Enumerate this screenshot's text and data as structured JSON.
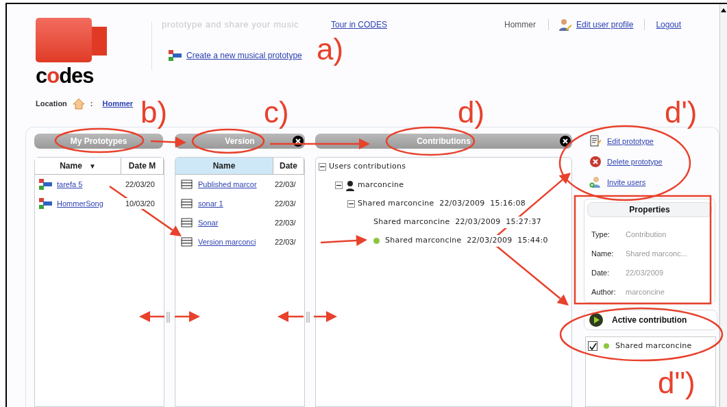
{
  "logo": {
    "text": "codes"
  },
  "header": {
    "tagline": "prototype and share your music",
    "tour_link": "Tour in CODES",
    "create_link": "Create a new musical prototype",
    "user": "Hommer",
    "edit_profile": "Edit user profile",
    "logout": "Logout"
  },
  "location": {
    "label": "Location",
    "separator": ":",
    "link": "Hommer"
  },
  "prototypes": {
    "title": "My Prototypes",
    "columns": [
      {
        "label": "Name",
        "sort_indicator": "▼",
        "selected": false
      },
      {
        "label": "Date M",
        "selected": false
      }
    ],
    "rows": [
      {
        "name": "tarefa 5",
        "date": "22/03/20"
      },
      {
        "name": "HommerSong",
        "date": "10/03/20"
      }
    ]
  },
  "versions": {
    "title": "Version",
    "closable": true,
    "columns": [
      {
        "label": "Name",
        "selected": true
      },
      {
        "label": "Date",
        "selected": false
      }
    ],
    "rows": [
      {
        "name": "Published marcor",
        "date": "22/03/"
      },
      {
        "name": "sonar 1",
        "date": "22/03/"
      },
      {
        "name": "Sonar",
        "date": "22/03/"
      },
      {
        "name": "Version marconci",
        "date": "22/03/"
      }
    ]
  },
  "contributions": {
    "title": "Contributions",
    "closable": true,
    "tree": [
      {
        "label": "Users contributions",
        "expanded": true,
        "children": [
          {
            "label": "marconcine",
            "kind": "user",
            "expanded": true,
            "children": [
              {
                "label": "Shared marconcine  22/03/2009  15:16:08",
                "expanded": true,
                "active": false,
                "children": [
                  {
                    "label": "Shared marconcine  22/03/2009  15:27:37",
                    "active": false
                  },
                  {
                    "label": "Shared marconcine  22/03/2009  15:44:0",
                    "active": true
                  }
                ]
              }
            ]
          }
        ]
      }
    ]
  },
  "actions": [
    {
      "label": "Edit prototype",
      "kind": "edit"
    },
    {
      "label": "Delete prototype",
      "kind": "delete"
    },
    {
      "label": "Invite users",
      "kind": "invite"
    }
  ],
  "properties": {
    "title": "Properties",
    "fields": [
      {
        "label": "Type:",
        "value": "Contribution"
      },
      {
        "label": "Name:",
        "value": "Shared marconc..."
      },
      {
        "label": "Date:",
        "value": "22/03/2009"
      },
      {
        "label": "Author:",
        "value": "marconcine"
      }
    ]
  },
  "active_contribution": {
    "title": "Active contribution",
    "items": [
      {
        "label": "Shared marconcine",
        "checked": true,
        "active": true
      }
    ]
  },
  "annotations": [
    {
      "label": "a)"
    },
    {
      "label": "b)"
    },
    {
      "label": "c)"
    },
    {
      "label": "d)"
    },
    {
      "label": "d')"
    },
    {
      "label": "d\")"
    }
  ]
}
